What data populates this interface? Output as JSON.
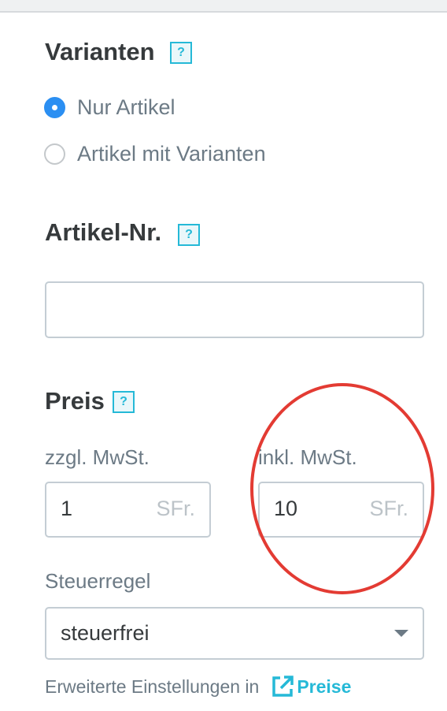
{
  "variants": {
    "title": "Varianten",
    "help": "?",
    "options": [
      {
        "label": "Nur Artikel",
        "checked": true
      },
      {
        "label": "Artikel mit Varianten",
        "checked": false
      }
    ]
  },
  "sku": {
    "title": "Artikel-Nr.",
    "help": "?",
    "value": ""
  },
  "price": {
    "title": "Preis",
    "help": "?",
    "excl_label": "zzgl. MwSt.",
    "excl_value": "1",
    "incl_label": "inkl. MwSt.",
    "incl_value": "10",
    "currency": "SFr."
  },
  "tax": {
    "label": "Steuerregel",
    "selected": "steuerfrei"
  },
  "footer": {
    "text": "Erweiterte Einstellungen in",
    "link": "Preise"
  },
  "colors": {
    "accent": "#25b9d7",
    "radio_checked": "#2b8ff2",
    "annotation": "#e33b33"
  }
}
